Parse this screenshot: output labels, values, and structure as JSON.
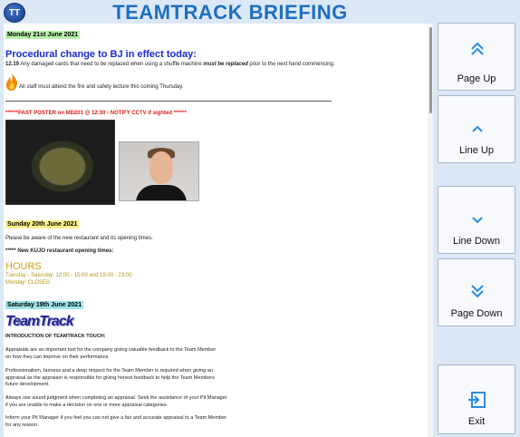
{
  "header": {
    "logo_text": "TT",
    "title": "TEAMTRACK BRIEFING"
  },
  "briefing": {
    "day1": {
      "date": "Monday 21st June 2021",
      "heading": "Procedural change to BJ in effect today:",
      "rule_number": "12.19",
      "rule_text": "Any damaged cards that need to be replaced when using a shuffle machine",
      "rule_emphasis": "must be replaced",
      "rule_end": "prior to the next hand commencing.",
      "fire_text": "All staff must attend the fire and safety lecture this coming Thursday.",
      "alert": "******PAST POSTER on MD201 @ 12:30 - NOTIFY CCTV if sighted ******"
    },
    "day2": {
      "date": "Sunday 20th June 2021",
      "text1": "Please be aware of the new restaurant and its opening times.",
      "text2": "***** New KUJO restaurant opening times:",
      "hours_title": "HOURS",
      "hours_line1": "Tuesday - Saturday: 12:00 - 15:00 and 19:00 - 23:00",
      "hours_line2": "Monday: CLOSED"
    },
    "day3": {
      "date": "Saturday 19th June 2021",
      "logo_text": "TeamTrack",
      "intro": "INTRODUCTION OF TEAMTRACK TOUCH:",
      "p1a": "Appraisals are an important tool for the company giving valuable feedback to the Team Member",
      "p1b": "on how they can improve on their performance.",
      "p2a": "Professionalism, fairness and a deep respect for the Team Member is required when giving an",
      "p2b": "appraisal as the appraiser is responsible for giving honest feedback to help the Team Members",
      "p2c": "future development.",
      "p3a": "Always use sound judgment when completing an appraisal.  Seek the assistance of your Pit Manager",
      "p3b": "if you are unable to make a decision on one or more appraisal categories.",
      "p4a": "Inform your Pit Manager if you feel you can not give a fair and accurate appraisal to a Team Member",
      "p4b": "for any reason."
    }
  },
  "nav": {
    "page_up": "Page Up",
    "line_up": "Line Up",
    "line_down": "Line Down",
    "page_down": "Page Down",
    "exit": "Exit"
  },
  "colors": {
    "accent": "#1d6fc2",
    "icon": "#2a8be0"
  }
}
